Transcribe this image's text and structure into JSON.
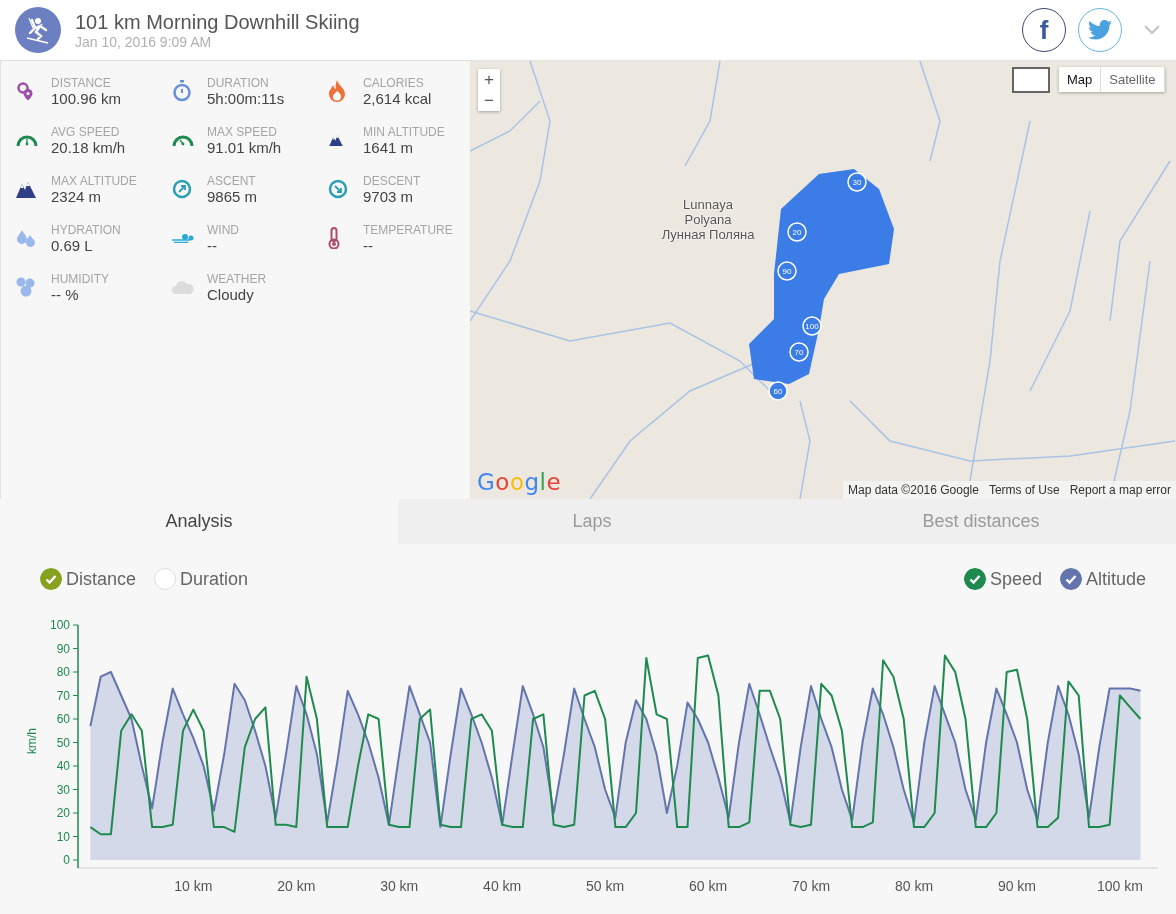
{
  "header": {
    "title": "101 km Morning Downhill Skiing",
    "date": "Jan 10, 2016 9:09 AM",
    "share_buttons": [
      {
        "kind": "facebook",
        "glyph": "f"
      },
      {
        "kind": "twitter"
      }
    ]
  },
  "stats": [
    {
      "kind": "distance",
      "label": "DISTANCE",
      "value": "100.96 km"
    },
    {
      "kind": "duration",
      "label": "DURATION",
      "value": "5h:00m:11s"
    },
    {
      "kind": "calories",
      "label": "CALORIES",
      "value": "2,614 kcal"
    },
    {
      "kind": "avg_speed",
      "label": "AVG SPEED",
      "value": "20.18 km/h"
    },
    {
      "kind": "max_speed",
      "label": "MAX SPEED",
      "value": "91.01 km/h"
    },
    {
      "kind": "min_altitude",
      "label": "MIN ALTITUDE",
      "value": "1641 m"
    },
    {
      "kind": "max_altitude",
      "label": "MAX ALTITUDE",
      "value": "2324 m"
    },
    {
      "kind": "ascent",
      "label": "ASCENT",
      "value": "9865 m"
    },
    {
      "kind": "descent",
      "label": "DESCENT",
      "value": "9703 m"
    },
    {
      "kind": "hydration",
      "label": "HYDRATION",
      "value": "0.69 L"
    },
    {
      "kind": "wind",
      "label": "WIND",
      "value": "--"
    },
    {
      "kind": "temperature",
      "label": "TEMPERATURE",
      "value": "--"
    },
    {
      "kind": "humidity",
      "label": "HUMIDITY",
      "value": "-- %"
    },
    {
      "kind": "weather",
      "label": "WEATHER",
      "value": "Cloudy"
    }
  ],
  "map": {
    "zoom_in": "+",
    "zoom_out": "−",
    "map_types": [
      {
        "label": "Map",
        "selected": true
      },
      {
        "label": "Satellite",
        "selected": false
      }
    ],
    "place_label_latin": "Lunnaya Polyana",
    "place_label_cyrillic": "Лунная Поляна",
    "markers": [
      "30",
      "20",
      "90",
      "100",
      "70",
      "60"
    ],
    "logo": "Google",
    "attribution": [
      "Map data ©2016 Google",
      "Terms of Use",
      "Report a map error"
    ]
  },
  "tabs": [
    {
      "label": "Analysis",
      "selected": true
    },
    {
      "label": "Laps",
      "selected": false
    },
    {
      "label": "Best distances",
      "selected": false
    }
  ],
  "legend": {
    "axis_modes": [
      {
        "label": "Distance",
        "selected": true
      },
      {
        "label": "Duration",
        "selected": false
      }
    ],
    "series": [
      {
        "checked": true
      },
      {
        "checked": true
      }
    ]
  },
  "chart_data": {
    "type": "line",
    "ylabel": "km/h",
    "xlim": [
      -1.2,
      103.7
    ],
    "ylim": [
      -3.4,
      100
    ],
    "yticks": [
      0,
      10,
      20,
      30,
      40,
      50,
      60,
      70,
      80,
      90,
      100
    ],
    "xticks": [
      {
        "value": 10,
        "label": "10 km"
      },
      {
        "value": 20,
        "label": "20 km"
      },
      {
        "value": 30,
        "label": "30 km"
      },
      {
        "value": 40,
        "label": "40 km"
      },
      {
        "value": 50,
        "label": "50 km"
      },
      {
        "value": 60,
        "label": "60 km"
      },
      {
        "value": 70,
        "label": "70 km"
      },
      {
        "value": 80,
        "label": "80 km"
      },
      {
        "value": 90,
        "label": "90 km"
      },
      {
        "value": 100,
        "label": "100 km"
      }
    ],
    "x": [
      0,
      1,
      2,
      3,
      4,
      5,
      6,
      7,
      8,
      9,
      10,
      11,
      12,
      13,
      14,
      15,
      16,
      17,
      18,
      19,
      20,
      21,
      22,
      23,
      24,
      25,
      26,
      27,
      28,
      29,
      30,
      31,
      32,
      33,
      34,
      35,
      36,
      37,
      38,
      39,
      40,
      41,
      42,
      43,
      44,
      45,
      46,
      47,
      48,
      49,
      50,
      51,
      52,
      53,
      54,
      55,
      56,
      57,
      58,
      59,
      60,
      61,
      62,
      63,
      64,
      65,
      66,
      67,
      68,
      69,
      70,
      71,
      72,
      73,
      74,
      75,
      76,
      77,
      78,
      79,
      80,
      81,
      82,
      83,
      84,
      85,
      86,
      87,
      88,
      89,
      90,
      91,
      92,
      93,
      94,
      95,
      96,
      97,
      98,
      99,
      100,
      101,
      102
    ],
    "series": [
      {
        "name": "Speed",
        "color": "#1e8a4f",
        "values": [
          14,
          11,
          11,
          55,
          62,
          55,
          14,
          14,
          15,
          55,
          64,
          55,
          14,
          14,
          12,
          48,
          60,
          65,
          15,
          15,
          14,
          78,
          60,
          14,
          14,
          14,
          40,
          62,
          60,
          15,
          14,
          14,
          60,
          64,
          15,
          14,
          14,
          60,
          62,
          55,
          15,
          14,
          14,
          60,
          62,
          15,
          14,
          15,
          70,
          72,
          60,
          14,
          14,
          20,
          86,
          62,
          60,
          14,
          14,
          86,
          87,
          70,
          14,
          14,
          16,
          72,
          72,
          60,
          15,
          14,
          15,
          75,
          70,
          55,
          14,
          14,
          16,
          85,
          78,
          60,
          14,
          14,
          20,
          87,
          80,
          60,
          14,
          14,
          20,
          80,
          81,
          60,
          14,
          14,
          18,
          76,
          70,
          14,
          14,
          15,
          70,
          65,
          60
        ]
      },
      {
        "name": "Altitude",
        "type": "area",
        "color": "#6474ad",
        "values": [
          57,
          78,
          80,
          70,
          60,
          40,
          22,
          50,
          73,
          62,
          52,
          40,
          21,
          45,
          75,
          68,
          55,
          40,
          18,
          45,
          74,
          62,
          45,
          16,
          42,
          72,
          62,
          50,
          35,
          15,
          45,
          74,
          62,
          50,
          14,
          45,
          73,
          62,
          50,
          35,
          15,
          45,
          74,
          62,
          48,
          20,
          45,
          73,
          60,
          48,
          30,
          18,
          50,
          68,
          60,
          45,
          20,
          40,
          67,
          60,
          50,
          35,
          18,
          50,
          75,
          62,
          48,
          35,
          16,
          48,
          74,
          60,
          48,
          30,
          17,
          50,
          73,
          62,
          48,
          30,
          16,
          50,
          74,
          62,
          50,
          30,
          17,
          50,
          73,
          62,
          50,
          30,
          17,
          50,
          74,
          62,
          45,
          18,
          48,
          73,
          73,
          73,
          72
        ]
      }
    ]
  }
}
